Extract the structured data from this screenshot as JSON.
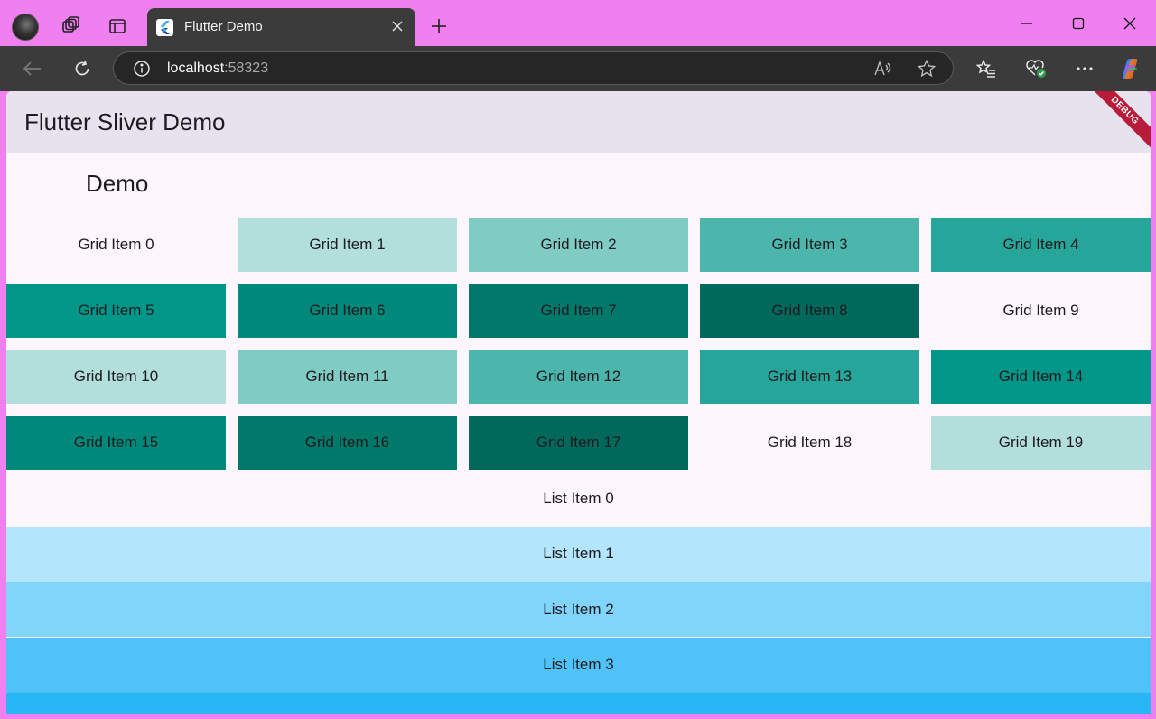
{
  "browser": {
    "tab_title": "Flutter Demo",
    "url_host": "localhost",
    "url_port": ":58323"
  },
  "app": {
    "title": "Flutter Sliver Demo",
    "debug_label": "DEBUG",
    "section_heading": "Demo",
    "grid": [
      {
        "label": "Grid Item 0",
        "color": "#fdf6fd"
      },
      {
        "label": "Grid Item 1",
        "color": "#b2dfdb"
      },
      {
        "label": "Grid Item 2",
        "color": "#80cbc4"
      },
      {
        "label": "Grid Item 3",
        "color": "#4db6ac"
      },
      {
        "label": "Grid Item 4",
        "color": "#26a69a"
      },
      {
        "label": "Grid Item 5",
        "color": "#009688"
      },
      {
        "label": "Grid Item 6",
        "color": "#00897b"
      },
      {
        "label": "Grid Item 7",
        "color": "#00796b"
      },
      {
        "label": "Grid Item 8",
        "color": "#00695c"
      },
      {
        "label": "Grid Item 9",
        "color": "#fdf6fd"
      },
      {
        "label": "Grid Item 10",
        "color": "#b2dfdb"
      },
      {
        "label": "Grid Item 11",
        "color": "#80cbc4"
      },
      {
        "label": "Grid Item 12",
        "color": "#4db6ac"
      },
      {
        "label": "Grid Item 13",
        "color": "#26a69a"
      },
      {
        "label": "Grid Item 14",
        "color": "#009688"
      },
      {
        "label": "Grid Item 15",
        "color": "#00897b"
      },
      {
        "label": "Grid Item 16",
        "color": "#00796b"
      },
      {
        "label": "Grid Item 17",
        "color": "#00695c"
      },
      {
        "label": "Grid Item 18",
        "color": "#fdf6fd"
      },
      {
        "label": "Grid Item 19",
        "color": "#b2dfdb"
      }
    ],
    "list": [
      {
        "label": "List Item 0",
        "color": "#fdf6fd"
      },
      {
        "label": "List Item 1",
        "color": "#b3e5fc"
      },
      {
        "label": "List Item 2",
        "color": "#81d4fa"
      },
      {
        "label": "List Item 3",
        "color": "#4fc3f7"
      },
      {
        "label": "",
        "color": "#29b6f6"
      }
    ]
  }
}
